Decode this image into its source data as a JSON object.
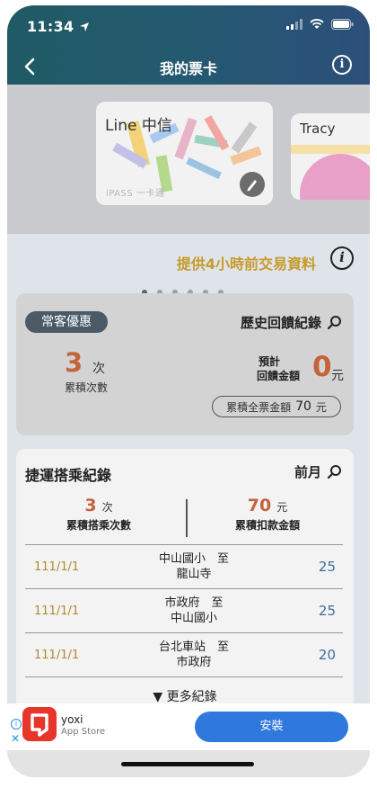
{
  "status_bar": {
    "time": "11:34"
  },
  "nav": {
    "title": "我的票卡"
  },
  "cards": [
    {
      "name": "Line 中信",
      "brand": "iPASS 一卡通"
    },
    {
      "name": "Tracy"
    }
  ],
  "carousel": {
    "count": 6,
    "active_index": 0
  },
  "notice": {
    "text": "提供4小時前交易資料"
  },
  "rewards": {
    "badge": "常客優惠",
    "history_link": "歷史回饋紀錄",
    "count_value": "3",
    "count_unit": "次",
    "count_label": "累積次數",
    "estimate_label_line1": "預計",
    "estimate_label_line2": "回饋金額",
    "estimate_value": "0",
    "estimate_unit": "元",
    "total_label": "累積全票金額",
    "total_value": "70",
    "total_unit": "元"
  },
  "rides": {
    "title": "捷運搭乘紀錄",
    "prev_month": "前月",
    "rides_value": "3",
    "rides_unit": "次",
    "rides_label": "累積搭乘次數",
    "amount_value": "70",
    "amount_unit": "元",
    "amount_label": "累積扣款金額",
    "rows": [
      {
        "date": "111/1/1",
        "from": "中山國小　至",
        "to": "龍山寺",
        "fare": "25"
      },
      {
        "date": "111/1/1",
        "from": "市政府　至",
        "to": "中山國小",
        "fare": "25"
      },
      {
        "date": "111/1/1",
        "from": "台北車站　至",
        "to": "市政府",
        "fare": "20"
      }
    ],
    "more": "▼ 更多紀錄"
  },
  "ad": {
    "app_name": "yoxi",
    "store": "App Store",
    "install": "安裝"
  },
  "colors": {
    "accent_orange": "#c4623a",
    "notice_gold": "#c79a2b",
    "fare_blue": "#3f6f9e",
    "install_blue": "#2f79de"
  }
}
